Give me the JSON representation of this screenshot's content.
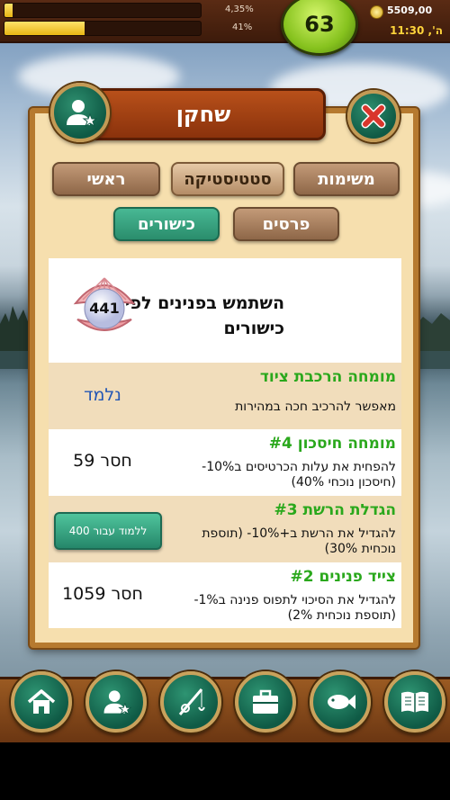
{
  "status_bar": {
    "xp_percent_label": "4,35%",
    "xp_fraction": 0.0435,
    "energy_percent_label": "41%",
    "energy_fraction": 0.41,
    "level": "63",
    "money": "5509,00",
    "time": "ה', 11:30"
  },
  "dialog": {
    "title": "שחקן",
    "tabs_row1": [
      "משימות",
      "סטטיסטיקה",
      "ראשי"
    ],
    "tabs_row2": [
      "פרסים",
      "כישורים"
    ],
    "pearl": {
      "count": "441",
      "text": "השתמש בפנינים לפיתוח כישורים"
    },
    "skills": [
      {
        "title": "מומחה הרכבת ציוד",
        "desc": "מאפשר להרכיב חכה במהירות",
        "status": "נלמד"
      },
      {
        "title": "מומחה חיסכון #4",
        "desc": "להפחית את עלות הכרטיסים ב10%- (חיסכון נוכחי 40%)",
        "status": "חסר 59"
      },
      {
        "title": "הגדלת הרשת #3",
        "desc": "להגדיל את הרשת ב+10%- (תוספת נוכחית 30%)",
        "button": "ללמוד עבור 400"
      },
      {
        "title": "צייד פנינים #2",
        "desc": "להגדיל את הסיכוי לתפוס פנינה ב1%- (תוספת נוכחית 2%)",
        "status": "חסר 1059"
      }
    ]
  },
  "bottom_nav": [
    "home-icon",
    "player-icon",
    "fishing-rod-icon",
    "briefcase-icon",
    "fish-icon",
    "book-icon"
  ],
  "colors": {
    "skill_title": "#2aa81c",
    "learned": "#2357b5",
    "panel": "#f6dfae"
  }
}
